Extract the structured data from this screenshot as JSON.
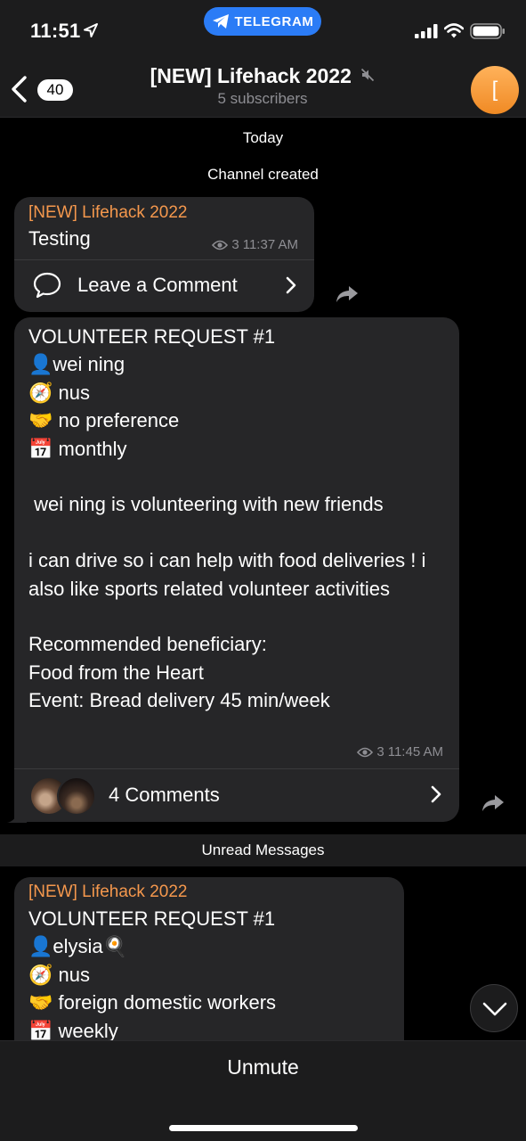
{
  "status_bar": {
    "time": "11:51",
    "pill_label": "TELEGRAM"
  },
  "header": {
    "back_count": "40",
    "title": "[NEW] Lifehack 2022",
    "subtitle": "5 subscribers",
    "avatar_letter": "["
  },
  "chat": {
    "date_label": "Today",
    "service_message": "Channel created",
    "unread_label": "Unread Messages",
    "messages": [
      {
        "author": "[NEW] Lifehack 2022",
        "text": "Testing",
        "views": "3",
        "time": "11:37 AM",
        "comment_label": "Leave a Comment"
      },
      {
        "text": "VOLUNTEER REQUEST #1\n👤wei ning\n🧭 nus\n🤝 no preference\n📅 monthly\n\n wei ning is volunteering with new friends\n\ni can drive so i can help with food deliveries ! i also like sports related volunteer activities\n\nRecommended beneficiary:\nFood from the Heart\nEvent: Bread delivery 45 min/week",
        "views": "3",
        "time": "11:45 AM",
        "comment_label": "4 Comments"
      },
      {
        "author": "[NEW] Lifehack 2022",
        "text": "VOLUNTEER REQUEST #1\n👤elysia🍳\n🧭 nus\n🤝 foreign domestic workers\n📅 weekly"
      }
    ]
  },
  "bottom_bar": {
    "action_label": "Unmute"
  },
  "colors": {
    "accent_blue": "#2b7cf6",
    "author_orange": "#f5984d",
    "bubble_bg": "#262628",
    "bar_bg": "#1c1c1d"
  }
}
